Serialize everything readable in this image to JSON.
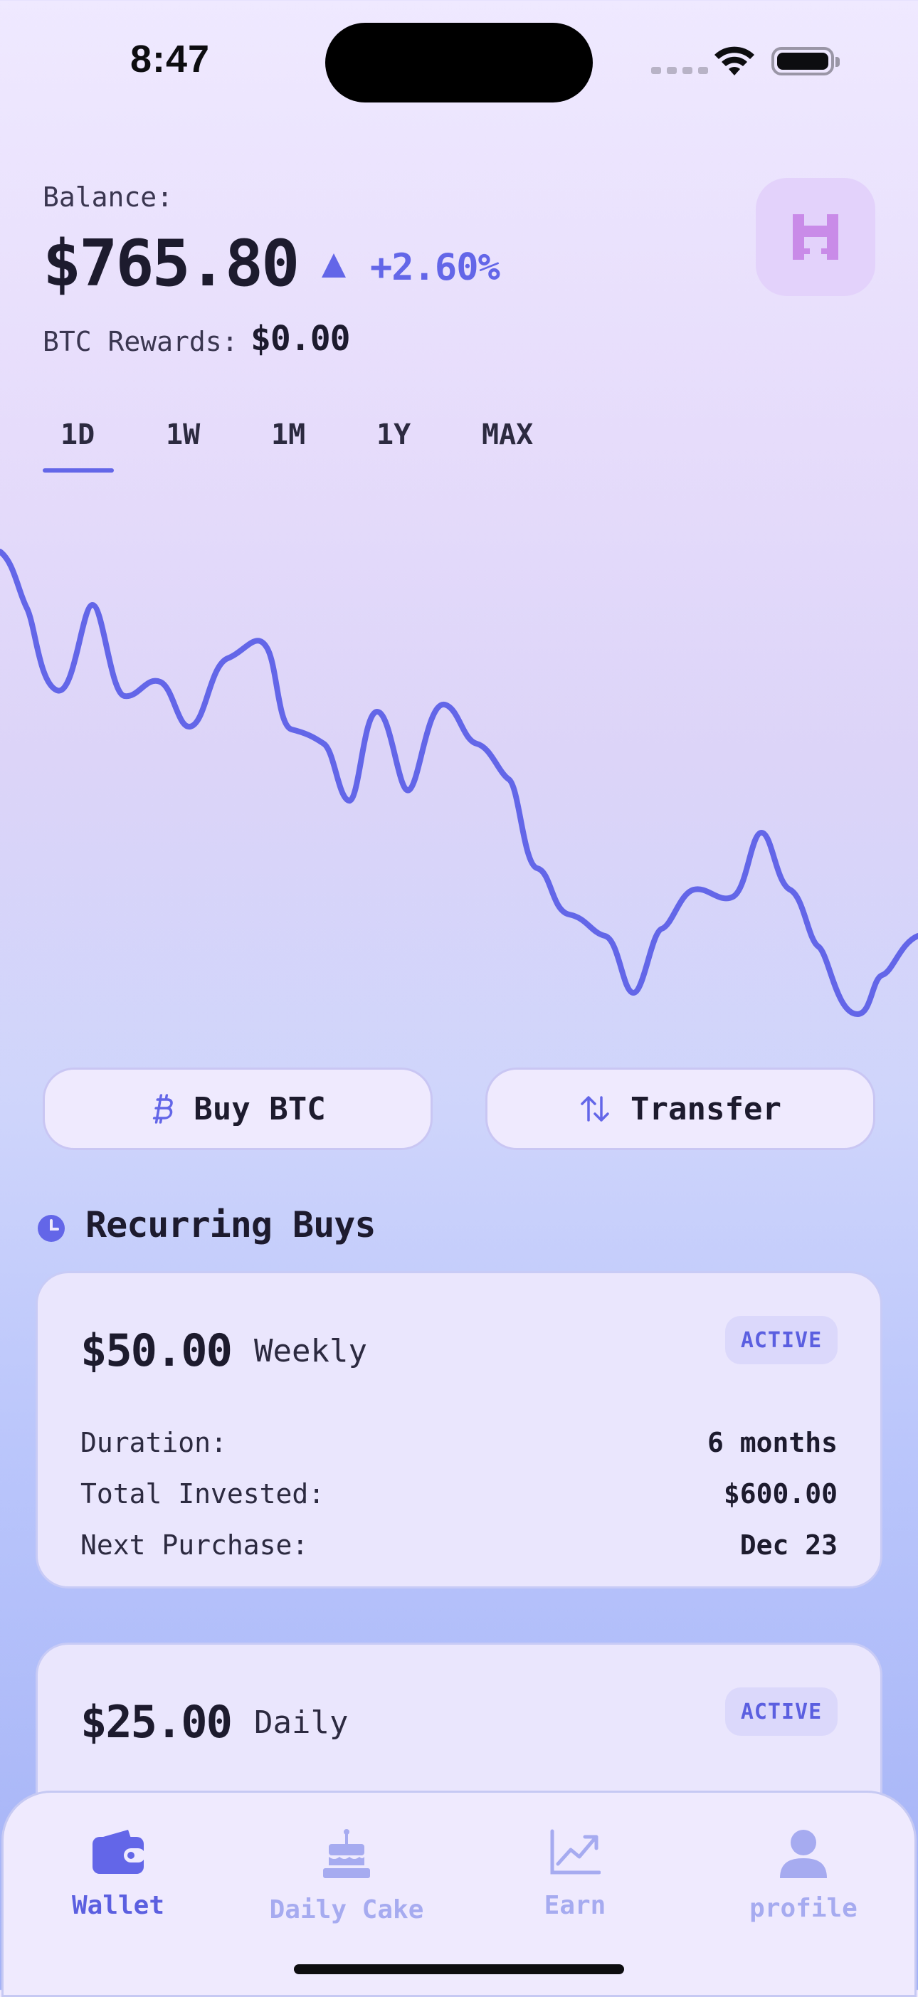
{
  "status_bar": {
    "time": "8:47"
  },
  "header": {
    "balance_label": "Balance:",
    "balance_value": "$765.80",
    "change": "+2.60%",
    "rewards_label": "BTC Rewards:",
    "rewards_value": "$0.00"
  },
  "tabs": [
    {
      "label": "1D",
      "active": true
    },
    {
      "label": "1W",
      "active": false
    },
    {
      "label": "1M",
      "active": false
    },
    {
      "label": "1Y",
      "active": false
    },
    {
      "label": "MAX",
      "active": false
    }
  ],
  "actions": {
    "buy_label": "Buy BTC",
    "transfer_label": "Transfer"
  },
  "recurring": {
    "title": "Recurring Buys",
    "cards": [
      {
        "amount": "$50.00",
        "frequency": "Weekly",
        "status": "ACTIVE",
        "rows": [
          {
            "label": "Duration:",
            "value": "6 months"
          },
          {
            "label": "Total Invested:",
            "value": "$600.00"
          },
          {
            "label": "Next Purchase:",
            "value": "Dec 23"
          }
        ]
      },
      {
        "amount": "$25.00",
        "frequency": "Daily",
        "status": "ACTIVE"
      }
    ]
  },
  "nav": [
    {
      "label": "Wallet",
      "icon": "wallet-icon",
      "active": true
    },
    {
      "label": "Daily Cake",
      "icon": "cake-icon",
      "active": false
    },
    {
      "label": "Earn",
      "icon": "chart-up-icon",
      "active": false
    },
    {
      "label": "profile",
      "icon": "user-icon",
      "active": false
    }
  ],
  "colors": {
    "accent": "#6366e8",
    "accent_light": "#a6abf0",
    "badge_bg": "#dbd8fb",
    "card_bg": "#eae6fd",
    "avatar_bg": "#e3d2fb",
    "avatar_glyph": "#c98be8"
  }
}
